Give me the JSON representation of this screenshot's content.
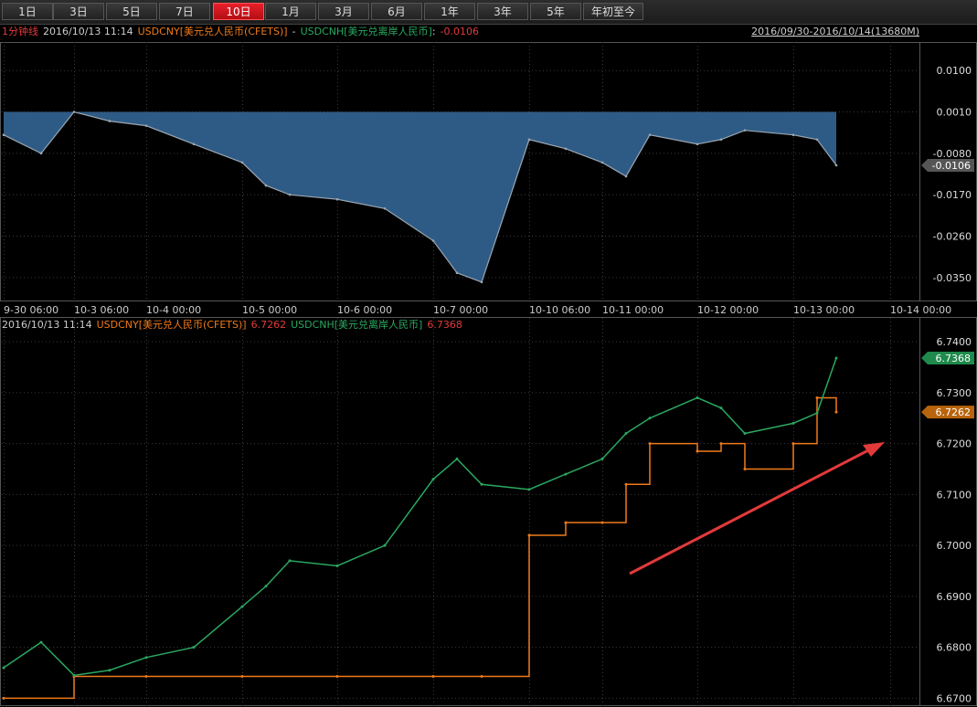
{
  "toolbar": {
    "tabs": [
      "1日",
      "3日",
      "5日",
      "7日",
      "10日",
      "1月",
      "3月",
      "6月",
      "1年",
      "3年",
      "5年",
      "年初至今"
    ],
    "active": "10日"
  },
  "top_header": {
    "interval": "1分钟线",
    "timestamp": "2016/10/13 11:14",
    "series_a": "USDCNY[美元兑人民币(CFETS)]",
    "sep": "-",
    "series_b": "USDCNH[美元兑离岸人民币]",
    "colon": ":",
    "value": "-0.0106",
    "range": "2016/09/30-2016/10/14(13680M)"
  },
  "bottom_header": {
    "timestamp": "2016/10/13 11:14",
    "cny_label": "USDCNY[美元兑人民币(CFETS)]",
    "cny_value": "6.7262",
    "cnh_label": "USDCNH[美元兑离岸人民币]",
    "cnh_value": "6.7368"
  },
  "x_axis": {
    "labels": [
      "9-30 06:00",
      "10-3 06:00",
      "10-4 00:00",
      "10-5 00:00",
      "10-6 00:00",
      "10-7 00:00",
      "10-10 06:00",
      "10-11 00:00",
      "10-12 00:00",
      "10-13 00:00",
      "10-14 00:00"
    ]
  },
  "colors": {
    "cny": "#f07a1a",
    "cnh": "#2aa860",
    "spread_fill": "#2e5b85",
    "spread_line": "#9aa6b2",
    "arrow": "#e23a3a",
    "grid": "#3a3a3a"
  },
  "chart_data": [
    {
      "type": "area",
      "name": "spread",
      "series": [
        {
          "name": "USDCNY - USDCNH",
          "x": [
            "9-30 06:00",
            "9-30 12:00",
            "10-3 06:00",
            "10-3 12:00",
            "10-4 00:00",
            "10-4 12:00",
            "10-5 00:00",
            "10-5 06:00",
            "10-5 12:00",
            "10-6 00:00",
            "10-6 12:00",
            "10-7 00:00",
            "10-7 06:00",
            "10-7 12:00",
            "10-10 06:00",
            "10-10 12:00",
            "10-11 00:00",
            "10-11 06:00",
            "10-11 12:00",
            "10-12 00:00",
            "10-12 06:00",
            "10-12 12:00",
            "10-13 00:00",
            "10-13 06:00",
            "10-13 11:14"
          ],
          "values": [
            -0.004,
            -0.008,
            0.001,
            -0.001,
            -0.002,
            -0.006,
            -0.01,
            -0.015,
            -0.017,
            -0.018,
            -0.02,
            -0.027,
            -0.034,
            -0.036,
            -0.005,
            -0.007,
            -0.01,
            -0.013,
            -0.004,
            -0.006,
            -0.005,
            -0.003,
            -0.004,
            -0.005,
            -0.0106
          ]
        }
      ],
      "y_ticks": [
        0.01,
        0.001,
        -0.008,
        -0.017,
        -0.026,
        -0.035
      ],
      "y_tick_labels": [
        "0.0100",
        "0.0010",
        "-0.0080",
        "-0.0170",
        "-0.0260",
        "-0.0350"
      ],
      "ylim": [
        -0.04,
        0.016
      ],
      "last_value": "-0.0106"
    },
    {
      "type": "line",
      "name": "rates",
      "series": [
        {
          "name": "USDCNY[美元兑人民币(CFETS)]",
          "color": "#f07a1a",
          "x": [
            "9-30 06:00",
            "10-3 06:00",
            "10-4 00:00",
            "10-5 00:00",
            "10-6 00:00",
            "10-7 00:00",
            "10-7 12:00",
            "10-10 06:00",
            "10-10 12:00",
            "10-11 00:00",
            "10-11 06:00",
            "10-11 12:00",
            "10-12 00:00",
            "10-12 06:00",
            "10-12 12:00",
            "10-13 00:00",
            "10-13 06:00",
            "10-13 11:14"
          ],
          "values": [
            6.67,
            6.6743,
            6.6743,
            6.6743,
            6.6743,
            6.6743,
            6.6743,
            6.702,
            6.7045,
            6.7045,
            6.712,
            6.72,
            6.7185,
            6.72,
            6.715,
            6.72,
            6.729,
            6.7262
          ]
        },
        {
          "name": "USDCNH[美元兑离岸人民币]",
          "color": "#2aa860",
          "x": [
            "9-30 06:00",
            "9-30 12:00",
            "10-3 06:00",
            "10-3 12:00",
            "10-4 00:00",
            "10-4 12:00",
            "10-5 00:00",
            "10-5 06:00",
            "10-5 12:00",
            "10-6 00:00",
            "10-6 12:00",
            "10-7 00:00",
            "10-7 06:00",
            "10-7 12:00",
            "10-10 06:00",
            "10-10 12:00",
            "10-11 00:00",
            "10-11 06:00",
            "10-11 12:00",
            "10-12 00:00",
            "10-12 06:00",
            "10-12 12:00",
            "10-13 00:00",
            "10-13 06:00",
            "10-13 11:14"
          ],
          "values": [
            6.676,
            6.681,
            6.6745,
            6.6755,
            6.678,
            6.68,
            6.688,
            6.692,
            6.697,
            6.696,
            6.7,
            6.713,
            6.717,
            6.712,
            6.711,
            6.714,
            6.717,
            6.722,
            6.725,
            6.729,
            6.727,
            6.722,
            6.724,
            6.726,
            6.7368
          ]
        }
      ],
      "y_ticks": [
        6.74,
        6.73,
        6.72,
        6.71,
        6.7,
        6.69,
        6.68,
        6.67
      ],
      "y_tick_labels": [
        "6.7400",
        "6.7300",
        "6.7200",
        "6.7100",
        "6.7000",
        "6.6900",
        "6.6800",
        "6.6700"
      ],
      "ylim": [
        6.669,
        6.742
      ],
      "last_values": {
        "cnh": "6.7368",
        "cny": "6.7262"
      }
    }
  ]
}
